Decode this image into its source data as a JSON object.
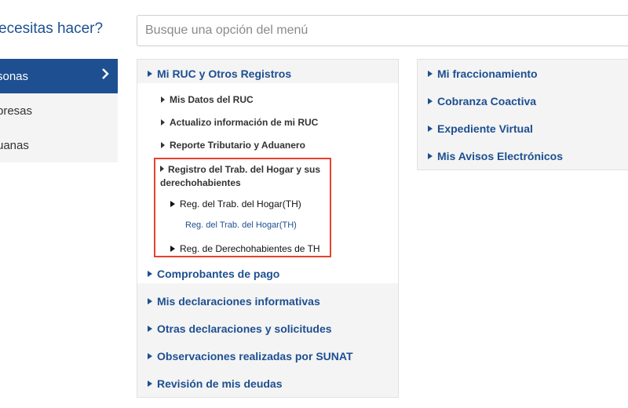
{
  "header": {
    "question": "ecesitas hacer?",
    "search_placeholder": "Busque una opción del menú"
  },
  "sidebar": {
    "items": [
      {
        "label": "sonas",
        "active": true
      },
      {
        "label": "presas",
        "active": false
      },
      {
        "label": "uanas",
        "active": false
      }
    ]
  },
  "menu_middle": {
    "section": "Mi RUC y Otros Registros",
    "sub_items": [
      "Mis Datos del RUC",
      "Actualizo información de mi RUC",
      "Reporte Tributario y Aduanero",
      "Registro del Trab. del Hogar y sus derechohabientes"
    ],
    "nested": {
      "reg_th": "Reg. del Trab. del Hogar(TH)",
      "reg_th_link": "Reg. del Trab. del Hogar(TH)",
      "reg_der": "Reg. de Derechohabientes de TH"
    },
    "sections": [
      "Comprobantes de pago",
      "Mis declaraciones informativas",
      "Otras declaraciones y solicitudes",
      "Observaciones realizadas por SUNAT",
      "Revisión de mis deudas"
    ]
  },
  "menu_right": {
    "sections": [
      "Mi fraccionamiento",
      "Cobranza Coactiva",
      "Expediente Virtual",
      "Mis Avisos Electrónicos"
    ]
  },
  "colors": {
    "brand_blue": "#1d4f91",
    "highlight_red": "#e8412d",
    "panel_gray": "#f4f4f4"
  },
  "icons": {
    "active_chevron": "chevron-right-icon",
    "expand": "triangle-right-icon"
  }
}
